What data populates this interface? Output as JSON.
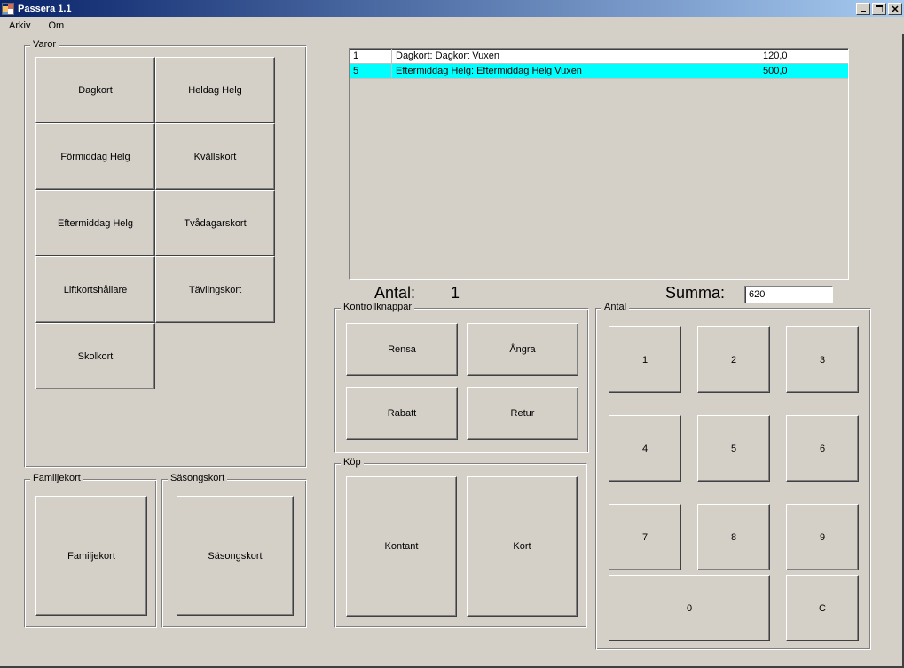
{
  "window": {
    "title": "Passera 1.1"
  },
  "menu": {
    "arkiv": "Arkiv",
    "om": "Om"
  },
  "groups": {
    "varor": "Varor",
    "kontroll": "Kontrollknappar",
    "kop": "Köp",
    "antal": "Antal",
    "familjekort": "Familjekort",
    "sasongskort": "Säsongskort"
  },
  "varor": {
    "dagkort": "Dagkort",
    "heldag": "Heldag Helg",
    "formiddag": "Förmiddag Helg",
    "kvall": "Kvällskort",
    "eftermiddag": "Eftermiddag Helg",
    "tvadagar": "Tvådagarskort",
    "liftkort": "Liftkortshållare",
    "tavling": "Tävlingskort",
    "skolkort": "Skolkort"
  },
  "familjekort_btn": "Familjekort",
  "sasongskort_btn": "Säsongskort",
  "kontroll": {
    "rensa": "Rensa",
    "angra": "Ångra",
    "rabatt": "Rabatt",
    "retur": "Retur"
  },
  "kop": {
    "kontant": "Kontant",
    "kort": "Kort"
  },
  "keypad": {
    "1": "1",
    "2": "2",
    "3": "3",
    "4": "4",
    "5": "5",
    "6": "6",
    "7": "7",
    "8": "8",
    "9": "9",
    "0": "0",
    "c": "C"
  },
  "cart": {
    "rows": [
      {
        "qty": "1",
        "desc": "Dagkort: Dagkort Vuxen",
        "price": "120,0",
        "selected": false
      },
      {
        "qty": "5",
        "desc": "Eftermiddag Helg: Eftermiddag Helg Vuxen",
        "price": "500,0",
        "selected": true
      }
    ]
  },
  "summary": {
    "antal_label": "Antal:",
    "antal_val": "1",
    "summa_label": "Summa:",
    "summa_val": "620"
  }
}
